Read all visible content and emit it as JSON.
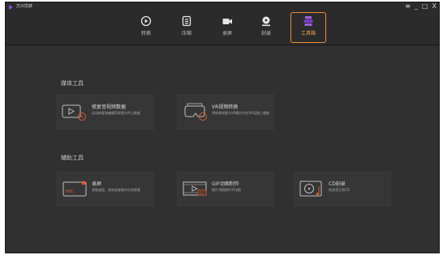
{
  "app": {
    "title": "万兴优转"
  },
  "window_controls": {
    "menu": "≡",
    "minimize": "_",
    "maximize": "□",
    "close": "X"
  },
  "tabs": [
    {
      "label": "转换",
      "icon": "convert-icon",
      "active": false
    },
    {
      "label": "压缩",
      "icon": "compress-icon",
      "active": false
    },
    {
      "label": "录屏",
      "icon": "record-icon",
      "active": false
    },
    {
      "label": "刻录",
      "icon": "burn-icon",
      "active": false
    },
    {
      "label": "工具箱",
      "icon": "toolbox-icon",
      "active": true
    }
  ],
  "sections": [
    {
      "title": "媒体工具",
      "cards": [
        {
          "title": "修复音视频数据",
          "desc": "自动修复和编辑音视频文件元数据",
          "icon": "metadata-icon"
        },
        {
          "title": "VR视频转换",
          "desc": "将视频转换为VR模式并在VR设备上播放",
          "icon": "vr-icon"
        }
      ]
    },
    {
      "title": "辅助工具",
      "cards": [
        {
          "title": "录屏",
          "desc": "录制桌面、游戏或者制作在线视频",
          "icon": "screen-record-icon"
        },
        {
          "title": "GIF动图制作",
          "desc": "图片/视频转GIF动图",
          "icon": "gif-icon"
        },
        {
          "title": "CD刻录",
          "desc": "刻录音乐到CD",
          "icon": "cd-burn-icon"
        }
      ]
    }
  ],
  "colors": {
    "accent": "#f08c38",
    "window_bg": "#2b2b2b",
    "card_bg": "#363636",
    "logo": "#8a4fd6"
  }
}
